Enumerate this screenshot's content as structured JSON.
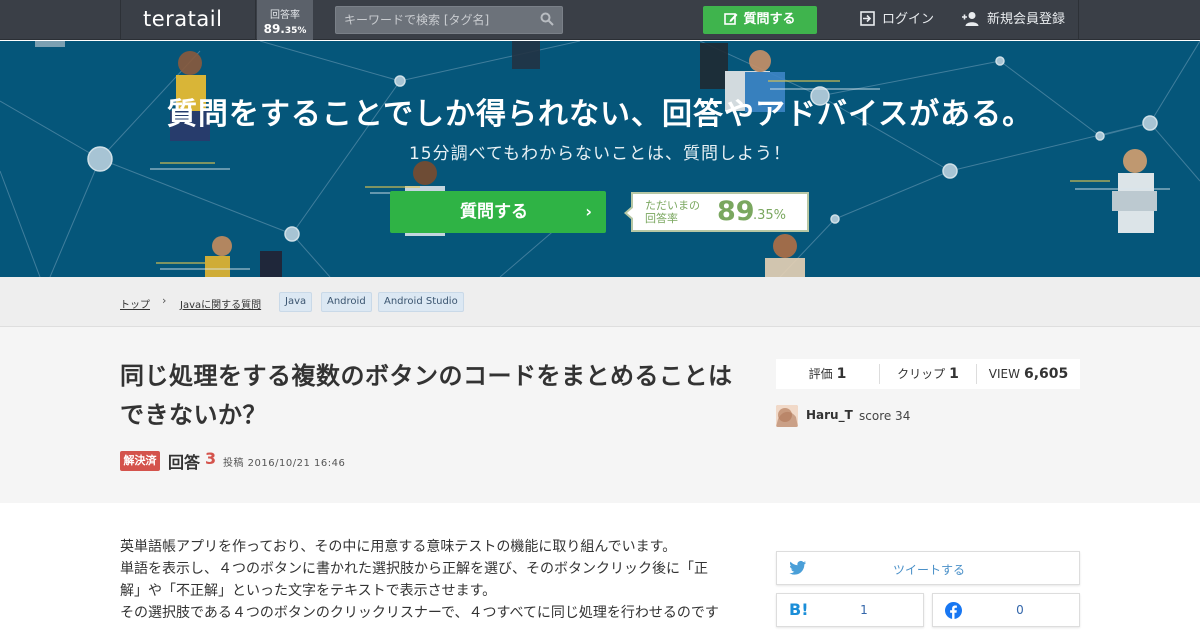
{
  "header": {
    "logo": "teratail",
    "rate_label": "回答率",
    "rate_value": "89.",
    "rate_decimal": "35%",
    "search_placeholder": "キーワードで検索 [タグ名]",
    "ask_label": "質問する",
    "login_label": "ログイン",
    "signup_label": "新規会員登録"
  },
  "hero": {
    "title": "質問をすることでしか得られない、回答やアドバイスがある。",
    "subtitle": "15分調べてもわからないことは、質問しよう！",
    "ask_button": "質問する",
    "arrow": "›",
    "rate_label_line1": "ただいまの",
    "rate_label_line2": "回答率",
    "rate_big": "89",
    "rate_small": ".35%"
  },
  "breadcrumb": {
    "top": "トップ",
    "sep": "›",
    "category": "Javaに関する質問",
    "tags": [
      "Java",
      "Android",
      "Android Studio"
    ]
  },
  "question": {
    "title": "同じ処理をする複数のボタンのコードをまとめることはできないか？",
    "solved_badge": "解決済",
    "answers_label": "回答",
    "answers_count": "3",
    "posted": "投稿 2016/10/21 16:46",
    "stats": {
      "rating_label": "評価",
      "rating_value": "1",
      "clip_label": "クリップ",
      "clip_value": "1",
      "view_label": "VIEW",
      "view_value": "6,605"
    },
    "user": {
      "name": "Haru_T",
      "score": "score 34"
    }
  },
  "body": {
    "lines": [
      "英単語帳アプリを作っており、その中に用意する意味テストの機能に取り組んでいます。",
      "単語を表示し、４つのボタンに書かれた選択肢から正解を選び、そのボタンクリック後に「正",
      "解」や「不正解」といった文字をテキストで表示させます。",
      "その選択肢である４つのボタンのクリックリスナーで、４つすべてに同じ処理を行わせるのです"
    ]
  },
  "share": {
    "tweet_label": "ツイートする",
    "hatena_count": "1",
    "facebook_count": "0"
  },
  "colors": {
    "header_bg": "#3a3f47",
    "hero_bg": "#05567a",
    "accent_green": "#2fb345",
    "solved_red": "#d4534c"
  }
}
